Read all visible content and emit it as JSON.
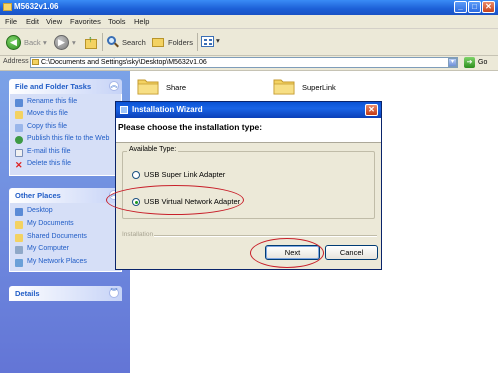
{
  "window": {
    "title": "M5632v1.06",
    "controls": {
      "minimize": "_",
      "maximize": "□",
      "close": "✕"
    }
  },
  "menubar": {
    "items": [
      "File",
      "Edit",
      "View",
      "Favorites",
      "Tools",
      "Help"
    ]
  },
  "toolbar": {
    "back_label": "Back",
    "search_label": "Search",
    "folders_label": "Folders"
  },
  "addressbar": {
    "label": "Address",
    "value": "C:\\Documents and Settings\\sky\\Desktop\\M5632v1.06",
    "go_label": "Go"
  },
  "sidebar": {
    "file_folder_tasks": {
      "title": "File and Folder Tasks",
      "items": [
        {
          "label": "Rename this file",
          "icon": "rename-icon"
        },
        {
          "label": "Move this file",
          "icon": "move-icon"
        },
        {
          "label": "Copy this file",
          "icon": "copy-icon"
        },
        {
          "label": "Publish this file to the Web",
          "icon": "publish-icon"
        },
        {
          "label": "E-mail this file",
          "icon": "email-icon"
        },
        {
          "label": "Delete this file",
          "icon": "delete-icon"
        }
      ]
    },
    "other_places": {
      "title": "Other Places",
      "items": [
        {
          "label": "Desktop",
          "icon": "desktop-icon"
        },
        {
          "label": "My Documents",
          "icon": "my-documents-icon"
        },
        {
          "label": "Shared Documents",
          "icon": "shared-documents-icon"
        },
        {
          "label": "My Computer",
          "icon": "my-computer-icon"
        },
        {
          "label": "My Network Places",
          "icon": "network-places-icon"
        }
      ]
    },
    "details": {
      "title": "Details"
    }
  },
  "content": {
    "folders": [
      {
        "label": "Share"
      },
      {
        "label": "SuperLink"
      }
    ]
  },
  "dialog": {
    "title": "Installation  Wizard",
    "question": "Please choose the installation type:",
    "group_label": "Available Type:",
    "options": [
      {
        "label": "USB Super Link Adapter",
        "selected": false
      },
      {
        "label": "USB Virtual Network Adapter",
        "selected": true
      }
    ],
    "installation_label": "Installation",
    "next_label": "Next",
    "cancel_label": "Cancel",
    "close": "✕"
  },
  "colors": {
    "xp_blue": "#1c5fd6",
    "task_pane": "#6f8ee0",
    "annotation_red": "#c8202a"
  }
}
